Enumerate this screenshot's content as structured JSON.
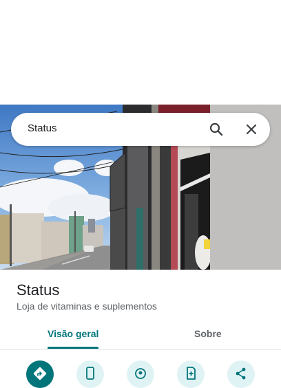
{
  "search": {
    "query": "Status"
  },
  "place": {
    "name": "Status",
    "category": "Loja de vitaminas e suplementos"
  },
  "tabs": [
    {
      "label": "Visão geral",
      "selected": true
    },
    {
      "label": "Sobre",
      "selected": false
    }
  ],
  "actions": [
    {
      "icon": "directions-icon"
    },
    {
      "icon": "phone-icon"
    },
    {
      "icon": "nearby-icon"
    },
    {
      "icon": "save-icon"
    },
    {
      "icon": "share-icon"
    }
  ],
  "colors": {
    "accent": "#00757a",
    "action_bg": "#e0f3f4"
  }
}
